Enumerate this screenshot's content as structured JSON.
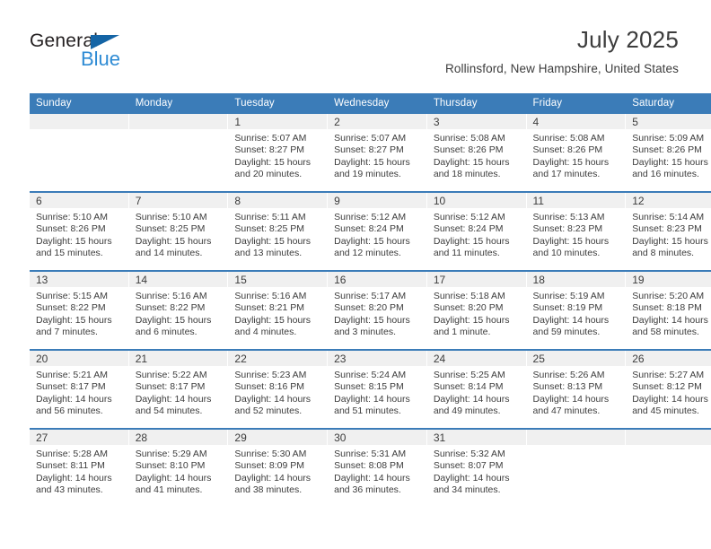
{
  "brand": {
    "name_part1": "General",
    "name_part2": "Blue",
    "flag_color": "#1464a5",
    "blue_color": "#2e8bd4"
  },
  "header": {
    "title": "July 2025",
    "location": "Rollinsford, New Hampshire, United States"
  },
  "theme": {
    "header_blue": "#3b7cb8",
    "daynum_band": "#f0f0f0",
    "text": "#3c3c3c"
  },
  "calendar": {
    "weekday_headers": [
      "Sunday",
      "Monday",
      "Tuesday",
      "Wednesday",
      "Thursday",
      "Friday",
      "Saturday"
    ],
    "labels": {
      "sunrise": "Sunrise:",
      "sunset": "Sunset:",
      "daylight": "Daylight:"
    },
    "weeks": [
      [
        {
          "day": "",
          "l1": "",
          "l2": "",
          "l3": "",
          "l4": ""
        },
        {
          "day": "",
          "l1": "",
          "l2": "",
          "l3": "",
          "l4": ""
        },
        {
          "day": "1",
          "l1": "Sunrise: 5:07 AM",
          "l2": "Sunset: 8:27 PM",
          "l3": "Daylight: 15 hours",
          "l4": "and 20 minutes."
        },
        {
          "day": "2",
          "l1": "Sunrise: 5:07 AM",
          "l2": "Sunset: 8:27 PM",
          "l3": "Daylight: 15 hours",
          "l4": "and 19 minutes."
        },
        {
          "day": "3",
          "l1": "Sunrise: 5:08 AM",
          "l2": "Sunset: 8:26 PM",
          "l3": "Daylight: 15 hours",
          "l4": "and 18 minutes."
        },
        {
          "day": "4",
          "l1": "Sunrise: 5:08 AM",
          "l2": "Sunset: 8:26 PM",
          "l3": "Daylight: 15 hours",
          "l4": "and 17 minutes."
        },
        {
          "day": "5",
          "l1": "Sunrise: 5:09 AM",
          "l2": "Sunset: 8:26 PM",
          "l3": "Daylight: 15 hours",
          "l4": "and 16 minutes."
        }
      ],
      [
        {
          "day": "6",
          "l1": "Sunrise: 5:10 AM",
          "l2": "Sunset: 8:26 PM",
          "l3": "Daylight: 15 hours",
          "l4": "and 15 minutes."
        },
        {
          "day": "7",
          "l1": "Sunrise: 5:10 AM",
          "l2": "Sunset: 8:25 PM",
          "l3": "Daylight: 15 hours",
          "l4": "and 14 minutes."
        },
        {
          "day": "8",
          "l1": "Sunrise: 5:11 AM",
          "l2": "Sunset: 8:25 PM",
          "l3": "Daylight: 15 hours",
          "l4": "and 13 minutes."
        },
        {
          "day": "9",
          "l1": "Sunrise: 5:12 AM",
          "l2": "Sunset: 8:24 PM",
          "l3": "Daylight: 15 hours",
          "l4": "and 12 minutes."
        },
        {
          "day": "10",
          "l1": "Sunrise: 5:12 AM",
          "l2": "Sunset: 8:24 PM",
          "l3": "Daylight: 15 hours",
          "l4": "and 11 minutes."
        },
        {
          "day": "11",
          "l1": "Sunrise: 5:13 AM",
          "l2": "Sunset: 8:23 PM",
          "l3": "Daylight: 15 hours",
          "l4": "and 10 minutes."
        },
        {
          "day": "12",
          "l1": "Sunrise: 5:14 AM",
          "l2": "Sunset: 8:23 PM",
          "l3": "Daylight: 15 hours",
          "l4": "and 8 minutes."
        }
      ],
      [
        {
          "day": "13",
          "l1": "Sunrise: 5:15 AM",
          "l2": "Sunset: 8:22 PM",
          "l3": "Daylight: 15 hours",
          "l4": "and 7 minutes."
        },
        {
          "day": "14",
          "l1": "Sunrise: 5:16 AM",
          "l2": "Sunset: 8:22 PM",
          "l3": "Daylight: 15 hours",
          "l4": "and 6 minutes."
        },
        {
          "day": "15",
          "l1": "Sunrise: 5:16 AM",
          "l2": "Sunset: 8:21 PM",
          "l3": "Daylight: 15 hours",
          "l4": "and 4 minutes."
        },
        {
          "day": "16",
          "l1": "Sunrise: 5:17 AM",
          "l2": "Sunset: 8:20 PM",
          "l3": "Daylight: 15 hours",
          "l4": "and 3 minutes."
        },
        {
          "day": "17",
          "l1": "Sunrise: 5:18 AM",
          "l2": "Sunset: 8:20 PM",
          "l3": "Daylight: 15 hours",
          "l4": "and 1 minute."
        },
        {
          "day": "18",
          "l1": "Sunrise: 5:19 AM",
          "l2": "Sunset: 8:19 PM",
          "l3": "Daylight: 14 hours",
          "l4": "and 59 minutes."
        },
        {
          "day": "19",
          "l1": "Sunrise: 5:20 AM",
          "l2": "Sunset: 8:18 PM",
          "l3": "Daylight: 14 hours",
          "l4": "and 58 minutes."
        }
      ],
      [
        {
          "day": "20",
          "l1": "Sunrise: 5:21 AM",
          "l2": "Sunset: 8:17 PM",
          "l3": "Daylight: 14 hours",
          "l4": "and 56 minutes."
        },
        {
          "day": "21",
          "l1": "Sunrise: 5:22 AM",
          "l2": "Sunset: 8:17 PM",
          "l3": "Daylight: 14 hours",
          "l4": "and 54 minutes."
        },
        {
          "day": "22",
          "l1": "Sunrise: 5:23 AM",
          "l2": "Sunset: 8:16 PM",
          "l3": "Daylight: 14 hours",
          "l4": "and 52 minutes."
        },
        {
          "day": "23",
          "l1": "Sunrise: 5:24 AM",
          "l2": "Sunset: 8:15 PM",
          "l3": "Daylight: 14 hours",
          "l4": "and 51 minutes."
        },
        {
          "day": "24",
          "l1": "Sunrise: 5:25 AM",
          "l2": "Sunset: 8:14 PM",
          "l3": "Daylight: 14 hours",
          "l4": "and 49 minutes."
        },
        {
          "day": "25",
          "l1": "Sunrise: 5:26 AM",
          "l2": "Sunset: 8:13 PM",
          "l3": "Daylight: 14 hours",
          "l4": "and 47 minutes."
        },
        {
          "day": "26",
          "l1": "Sunrise: 5:27 AM",
          "l2": "Sunset: 8:12 PM",
          "l3": "Daylight: 14 hours",
          "l4": "and 45 minutes."
        }
      ],
      [
        {
          "day": "27",
          "l1": "Sunrise: 5:28 AM",
          "l2": "Sunset: 8:11 PM",
          "l3": "Daylight: 14 hours",
          "l4": "and 43 minutes."
        },
        {
          "day": "28",
          "l1": "Sunrise: 5:29 AM",
          "l2": "Sunset: 8:10 PM",
          "l3": "Daylight: 14 hours",
          "l4": "and 41 minutes."
        },
        {
          "day": "29",
          "l1": "Sunrise: 5:30 AM",
          "l2": "Sunset: 8:09 PM",
          "l3": "Daylight: 14 hours",
          "l4": "and 38 minutes."
        },
        {
          "day": "30",
          "l1": "Sunrise: 5:31 AM",
          "l2": "Sunset: 8:08 PM",
          "l3": "Daylight: 14 hours",
          "l4": "and 36 minutes."
        },
        {
          "day": "31",
          "l1": "Sunrise: 5:32 AM",
          "l2": "Sunset: 8:07 PM",
          "l3": "Daylight: 14 hours",
          "l4": "and 34 minutes."
        },
        {
          "day": "",
          "l1": "",
          "l2": "",
          "l3": "",
          "l4": ""
        },
        {
          "day": "",
          "l1": "",
          "l2": "",
          "l3": "",
          "l4": ""
        }
      ]
    ]
  }
}
